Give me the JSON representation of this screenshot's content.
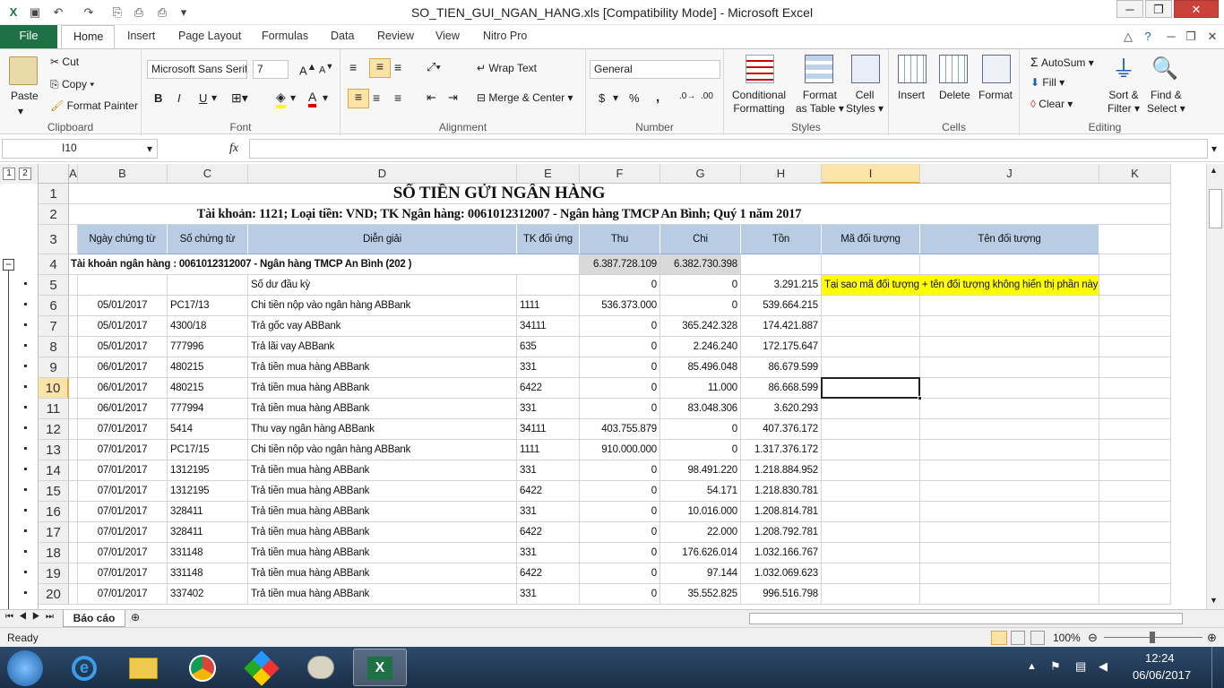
{
  "window": {
    "title": "SO_TIEN_GUI_NGAN_HANG.xls  [Compatibility Mode]  -  Microsoft Excel",
    "minimize": "─",
    "maximize": "❐",
    "close": "✕"
  },
  "tabs": [
    "File",
    "Home",
    "Insert",
    "Page Layout",
    "Formulas",
    "Data",
    "Review",
    "View",
    "Nitro Pro"
  ],
  "ribbon": {
    "clipboard": {
      "label": "Clipboard",
      "paste": "Paste",
      "cut": "Cut",
      "copy": "Copy",
      "format_painter": "Format Painter"
    },
    "font": {
      "label": "Font",
      "family": "Microsoft Sans Serif",
      "size": "7",
      "bold": "B",
      "italic": "I",
      "underline": "U"
    },
    "alignment": {
      "label": "Alignment",
      "wrap_text": "Wrap Text",
      "merge_center": "Merge & Center"
    },
    "number": {
      "label": "Number",
      "format": "General",
      "currency": "$",
      "percent": "%",
      "comma": ","
    },
    "styles": {
      "label": "Styles",
      "conditional": [
        "Conditional",
        "Formatting"
      ],
      "format_table": [
        "Format",
        "as Table"
      ],
      "cell_styles": [
        "Cell",
        "Styles"
      ]
    },
    "cells": {
      "label": "Cells",
      "insert": "Insert",
      "delete": "Delete",
      "format": "Format"
    },
    "editing": {
      "label": "Editing",
      "autosum": "AutoSum",
      "fill": "Fill",
      "clear": "Clear",
      "sort": [
        "Sort &",
        "Filter"
      ],
      "find": [
        "Find &",
        "Select"
      ]
    }
  },
  "formula_bar": {
    "name_box": "I10",
    "fx": "fx",
    "formula": ""
  },
  "outline_levels": [
    "1",
    "2"
  ],
  "columns": [
    {
      "letter": "A",
      "w": 10
    },
    {
      "letter": "B",
      "w": 100
    },
    {
      "letter": "C",
      "w": 90
    },
    {
      "letter": "D",
      "w": 300
    },
    {
      "letter": "E",
      "w": 70
    },
    {
      "letter": "F",
      "w": 90
    },
    {
      "letter": "G",
      "w": 90
    },
    {
      "letter": "H",
      "w": 90
    },
    {
      "letter": "I",
      "w": 110
    },
    {
      "letter": "J",
      "w": 200
    },
    {
      "letter": "K",
      "w": 80
    }
  ],
  "sheet": {
    "title": "SỔ TIỀN GỬI NGÂN HÀNG",
    "subtitle": "Tài khoản: 1121; Loại tiền: VND; TK Ngân hàng: 0061012312007 - Ngân hàng TMCP An Bình; Quý 1 năm 2017",
    "headers": [
      "Ngày chứng từ",
      "Số chứng từ",
      "Diễn giải",
      "TK đối ứng",
      "Thu",
      "Chi",
      "Tồn",
      "Mã đối tượng",
      "Tên đối tượng"
    ],
    "group_row": {
      "label": "Tài khoản ngân hàng : 0061012312007 - Ngân hàng TMCP An Bình (202 )",
      "thu": "6.387.728.109",
      "chi": "6.382.730.398"
    },
    "opening": {
      "label": "Số dư đầu kỳ",
      "thu": "0",
      "chi": "0",
      "ton": "3.291.215",
      "note": "Tại sao  mã đối tượng + tên đối tượng không hiển thị phần này"
    },
    "rows": [
      [
        "05/01/2017",
        "PC17/13",
        "Chi tiền nộp vào ngân hàng ABBank",
        "1111",
        "536.373.000",
        "0",
        "539.664.215"
      ],
      [
        "05/01/2017",
        "4300/18",
        "Trả gốc vay ABBank",
        "34111",
        "0",
        "365.242.328",
        "174.421.887"
      ],
      [
        "05/01/2017",
        "777996",
        "Trả lãi vay ABBank",
        "635",
        "0",
        "2.246.240",
        "172.175.647"
      ],
      [
        "06/01/2017",
        "480215",
        "Trả tiền mua hàng ABBank",
        "331",
        "0",
        "85.496.048",
        "86.679.599"
      ],
      [
        "06/01/2017",
        "480215",
        "Trả tiền mua hàng ABBank",
        "6422",
        "0",
        "11.000",
        "86.668.599"
      ],
      [
        "06/01/2017",
        "777994",
        "Trả tiền mua hàng ABBank",
        "331",
        "0",
        "83.048.306",
        "3.620.293"
      ],
      [
        "07/01/2017",
        "5414",
        "Thu vay ngân hàng ABBank",
        "34111",
        "403.755.879",
        "0",
        "407.376.172"
      ],
      [
        "07/01/2017",
        "PC17/15",
        "Chi tiền nộp vào ngân hàng ABBank",
        "1111",
        "910.000.000",
        "0",
        "1.317.376.172"
      ],
      [
        "07/01/2017",
        "1312195",
        "Trả tiền mua hàng ABBank",
        "331",
        "0",
        "98.491.220",
        "1.218.884.952"
      ],
      [
        "07/01/2017",
        "1312195",
        "Trả tiền mua hàng ABBank",
        "6422",
        "0",
        "54.171",
        "1.218.830.781"
      ],
      [
        "07/01/2017",
        "328411",
        "Trả tiền mua hàng ABBank",
        "331",
        "0",
        "10.016.000",
        "1.208.814.781"
      ],
      [
        "07/01/2017",
        "328411",
        "Trả tiền mua hàng ABBank",
        "6422",
        "0",
        "22.000",
        "1.208.792.781"
      ],
      [
        "07/01/2017",
        "331148",
        "Trả tiền mua hàng ABBank",
        "331",
        "0",
        "176.626.014",
        "1.032.166.767"
      ],
      [
        "07/01/2017",
        "331148",
        "Trả tiền mua hàng ABBank",
        "6422",
        "0",
        "97.144",
        "1.032.069.623"
      ],
      [
        "07/01/2017",
        "337402",
        "Trả tiền mua hàng ABBank",
        "331",
        "0",
        "35.552.825",
        "996.516.798"
      ]
    ],
    "row_numbers": [
      "1",
      "2",
      "3",
      "4",
      "5",
      "6",
      "7",
      "8",
      "9",
      "10",
      "11",
      "12",
      "13",
      "14",
      "15",
      "16",
      "17",
      "18",
      "19",
      "20"
    ]
  },
  "sheet_tabs": {
    "active": "Báo cáo"
  },
  "status": {
    "ready": "Ready",
    "zoom": "100%"
  },
  "taskbar": {
    "time": "12:24",
    "date": "06/06/2017"
  },
  "colors": {
    "header_fill": "#b8cce4",
    "note_fill": "#ffff00",
    "group_fill": "#d9d9d9",
    "excel_green": "#1e7145",
    "active_col": "#fce4a8"
  }
}
